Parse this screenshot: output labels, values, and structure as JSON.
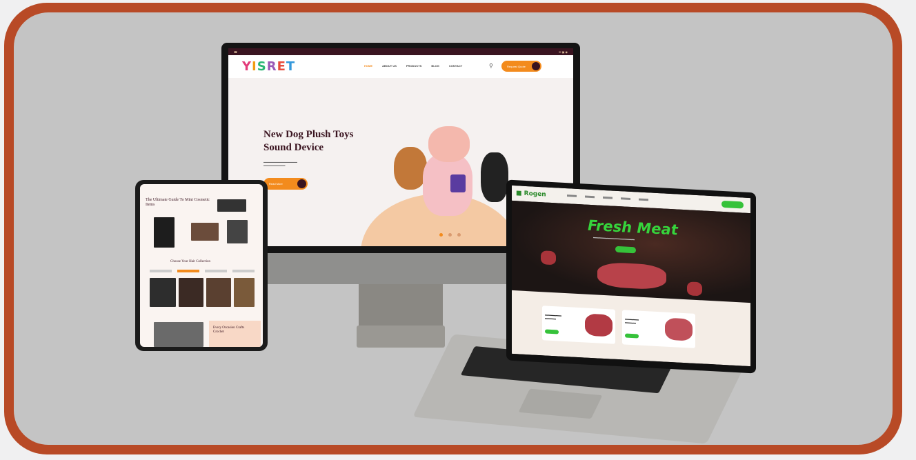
{
  "imac": {
    "logo": "YISRET",
    "nav": [
      "HOME",
      "ABOUT US",
      "PRODUCTS",
      "BLOG",
      "CONTACT"
    ],
    "cta": "Request Quote",
    "hero_title": "New Dog Plush Toys Sound Device",
    "hero_button": "Read More"
  },
  "tablet": {
    "title": "The Ultimate Guide To Mini Cosmetic Items",
    "section_title": "Choose Your Hair Collection",
    "card_title": "Every Occasion Crafts Crochet"
  },
  "laptop": {
    "hero_title": "Fresh Meat"
  },
  "colors": {
    "frame": "#b84a26",
    "stage": "#c4c4c4",
    "accent_orange": "#f38b1d",
    "accent_green": "#36c23a",
    "dark_plum": "#3a1420"
  }
}
